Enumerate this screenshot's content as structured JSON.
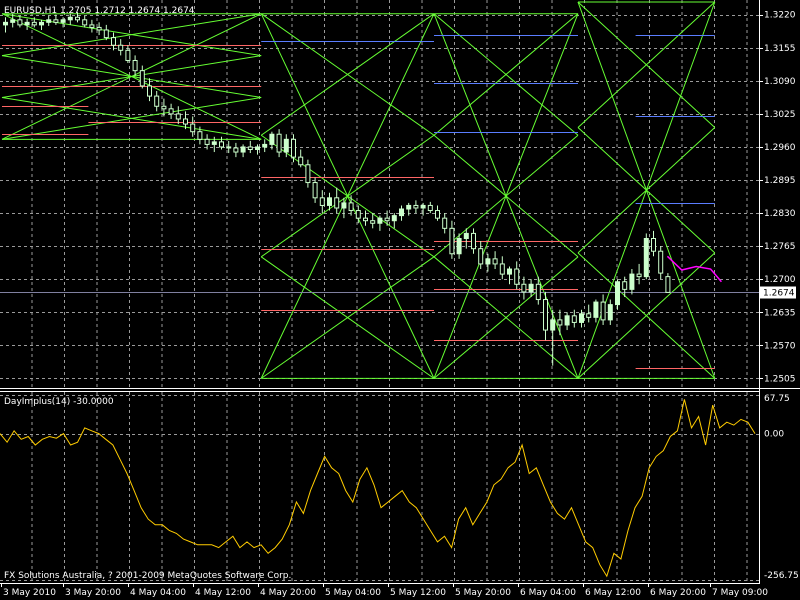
{
  "chart_data": [
    {
      "type": "candlestick",
      "header": "EURUSD,H1  1.2705 1.2712 1.2674 1.2674",
      "symbol": "EURUSD",
      "timeframe": "H1",
      "ohlc_header": [
        1.2705,
        1.2712,
        1.2674,
        1.2674
      ],
      "current_price": 1.2674,
      "current_price_label": "1.2674",
      "ylim": [
        1.249,
        1.3245
      ],
      "y_ticks": [
        1.322,
        1.3155,
        1.309,
        1.3025,
        1.296,
        1.2895,
        1.283,
        1.2765,
        1.27,
        1.2635,
        1.257,
        1.2505
      ],
      "y_tick_labels": [
        "1.3220",
        "1.3155",
        "1.3090",
        "1.3025",
        "1.2960",
        "1.2895",
        "1.2830",
        "1.2765",
        "1.2700",
        "1.2635",
        "1.2570",
        "1.2505"
      ],
      "x_tick_labels": [
        "3 May 2010",
        "3 May 20:00",
        "4 May 04:00",
        "4 May 12:00",
        "4 May 20:00",
        "5 May 04:00",
        "5 May 12:00",
        "5 May 20:00",
        "6 May 04:00",
        "6 May 12:00",
        "6 May 20:00",
        "7 May 09:00"
      ],
      "grid": true,
      "colors": {
        "background": "#000000",
        "grid": "#9a9a9a",
        "bull_candle": "#ccffcc",
        "bear_candle": "#000000",
        "candle_outline": "#ccffcc",
        "projection_lines": "#66ff33",
        "support_resistance": "#ff6666",
        "upper_levels": "#5a7dff",
        "forecast": "#ff00ff",
        "price_line": "#8080a0"
      },
      "candles_note": "hourly candles, open/high/low/close",
      "candles": [
        [
          1.32,
          1.3215,
          1.3185,
          1.3205
        ],
        [
          1.3205,
          1.3222,
          1.3195,
          1.321
        ],
        [
          1.321,
          1.3218,
          1.3195,
          1.32
        ],
        [
          1.32,
          1.3212,
          1.319,
          1.3205
        ],
        [
          1.3205,
          1.3215,
          1.3195,
          1.32
        ],
        [
          1.32,
          1.321,
          1.319,
          1.3205
        ],
        [
          1.3205,
          1.3218,
          1.3198,
          1.321
        ],
        [
          1.321,
          1.322,
          1.32,
          1.3205
        ],
        [
          1.3205,
          1.3215,
          1.3195,
          1.321
        ],
        [
          1.321,
          1.3222,
          1.32,
          1.3215
        ],
        [
          1.3215,
          1.3225,
          1.3205,
          1.321
        ],
        [
          1.321,
          1.3218,
          1.3195,
          1.32
        ],
        [
          1.32,
          1.321,
          1.3185,
          1.3195
        ],
        [
          1.3195,
          1.3205,
          1.318,
          1.319
        ],
        [
          1.319,
          1.32,
          1.317,
          1.3175
        ],
        [
          1.3175,
          1.3185,
          1.315,
          1.316
        ],
        [
          1.316,
          1.3172,
          1.314,
          1.315
        ],
        [
          1.315,
          1.316,
          1.3125,
          1.313
        ],
        [
          1.313,
          1.314,
          1.31,
          1.311
        ],
        [
          1.311,
          1.312,
          1.3075,
          1.308
        ],
        [
          1.308,
          1.3095,
          1.305,
          1.306
        ],
        [
          1.306,
          1.307,
          1.303,
          1.304
        ],
        [
          1.304,
          1.3055,
          1.302,
          1.3035
        ],
        [
          1.3035,
          1.3045,
          1.3015,
          1.3025
        ],
        [
          1.3025,
          1.304,
          1.3005,
          1.3015
        ],
        [
          1.3015,
          1.303,
          1.2995,
          1.3005
        ],
        [
          1.3005,
          1.302,
          1.298,
          1.299
        ],
        [
          1.299,
          1.3,
          1.2965,
          1.2975
        ],
        [
          1.2975,
          1.2985,
          1.2955,
          1.2965
        ],
        [
          1.2965,
          1.298,
          1.295,
          1.297
        ],
        [
          1.297,
          1.298,
          1.2955,
          1.296
        ],
        [
          1.296,
          1.2972,
          1.2948,
          1.2958
        ],
        [
          1.2958,
          1.2968,
          1.294,
          1.295
        ],
        [
          1.295,
          1.2965,
          1.294,
          1.296
        ],
        [
          1.296,
          1.2972,
          1.2948,
          1.2955
        ],
        [
          1.2955,
          1.2965,
          1.2945,
          1.296
        ],
        [
          1.296,
          1.2975,
          1.295,
          1.2965
        ],
        [
          1.2965,
          1.299,
          1.2955,
          1.2985
        ],
        [
          1.2985,
          1.2995,
          1.294,
          1.295
        ],
        [
          1.295,
          1.2985,
          1.294,
          1.2975
        ],
        [
          1.2975,
          1.2985,
          1.293,
          1.294
        ],
        [
          1.294,
          1.2955,
          1.292,
          1.2925
        ],
        [
          1.2925,
          1.2935,
          1.288,
          1.289
        ],
        [
          1.289,
          1.29,
          1.285,
          1.286
        ],
        [
          1.286,
          1.2875,
          1.283,
          1.2845
        ],
        [
          1.2845,
          1.287,
          1.2835,
          1.286
        ],
        [
          1.286,
          1.288,
          1.283,
          1.284
        ],
        [
          1.284,
          1.286,
          1.282,
          1.285
        ],
        [
          1.285,
          1.2865,
          1.2825,
          1.2835
        ],
        [
          1.2835,
          1.2845,
          1.281,
          1.282
        ],
        [
          1.282,
          1.2835,
          1.2805,
          1.2815
        ],
        [
          1.2815,
          1.283,
          1.28,
          1.281
        ],
        [
          1.281,
          1.2825,
          1.2795,
          1.282
        ],
        [
          1.282,
          1.2835,
          1.2805,
          1.2815
        ],
        [
          1.2815,
          1.283,
          1.28,
          1.2825
        ],
        [
          1.2825,
          1.2845,
          1.2815,
          1.2838
        ],
        [
          1.2838,
          1.285,
          1.2825,
          1.2845
        ],
        [
          1.2845,
          1.2855,
          1.283,
          1.284
        ],
        [
          1.284,
          1.285,
          1.2825,
          1.2845
        ],
        [
          1.2845,
          1.2852,
          1.283,
          1.2835
        ],
        [
          1.2835,
          1.2845,
          1.2815,
          1.282
        ],
        [
          1.282,
          1.283,
          1.279,
          1.28
        ],
        [
          1.28,
          1.2815,
          1.274,
          1.275
        ],
        [
          1.275,
          1.279,
          1.274,
          1.278
        ],
        [
          1.278,
          1.28,
          1.276,
          1.279
        ],
        [
          1.279,
          1.28,
          1.275,
          1.276
        ],
        [
          1.276,
          1.2775,
          1.272,
          1.273
        ],
        [
          1.273,
          1.275,
          1.2715,
          1.274
        ],
        [
          1.274,
          1.2755,
          1.272,
          1.273
        ],
        [
          1.273,
          1.2745,
          1.27,
          1.271
        ],
        [
          1.271,
          1.2725,
          1.269,
          1.272
        ],
        [
          1.272,
          1.2735,
          1.268,
          1.269
        ],
        [
          1.269,
          1.2705,
          1.266,
          1.2675
        ],
        [
          1.2675,
          1.27,
          1.2665,
          1.269
        ],
        [
          1.269,
          1.2705,
          1.265,
          1.266
        ],
        [
          1.266,
          1.2675,
          1.258,
          1.26
        ],
        [
          1.26,
          1.264,
          1.253,
          1.262
        ],
        [
          1.262,
          1.264,
          1.259,
          1.261
        ],
        [
          1.261,
          1.2635,
          1.26,
          1.2628
        ],
        [
          1.2628,
          1.264,
          1.2605,
          1.2615
        ],
        [
          1.2615,
          1.264,
          1.2605,
          1.2632
        ],
        [
          1.2632,
          1.265,
          1.2615,
          1.2625
        ],
        [
          1.2625,
          1.266,
          1.2615,
          1.2655
        ],
        [
          1.2655,
          1.267,
          1.261,
          1.262
        ],
        [
          1.262,
          1.266,
          1.261,
          1.265
        ],
        [
          1.265,
          1.27,
          1.264,
          1.2695
        ],
        [
          1.2695,
          1.2705,
          1.2665,
          1.268
        ],
        [
          1.268,
          1.272,
          1.267,
          1.271
        ],
        [
          1.271,
          1.273,
          1.269,
          1.2705
        ],
        [
          1.2705,
          1.279,
          1.27,
          1.278
        ],
        [
          1.278,
          1.2795,
          1.2745,
          1.2755
        ],
        [
          1.2755,
          1.2765,
          1.27,
          1.2712
        ],
        [
          1.2705,
          1.2712,
          1.2674,
          1.2674
        ]
      ],
      "projection_boxes": [
        {
          "x_from": 0,
          "x_to": 36,
          "top": 1.3222,
          "bottom": 1.2975
        },
        {
          "x_from": 36,
          "x_to": 60,
          "top": 1.3222,
          "bottom": 1.2505
        },
        {
          "x_from": 60,
          "x_to": 80,
          "top": 1.3222,
          "bottom": 1.2505
        },
        {
          "x_from": 80,
          "x_to": 99,
          "top": 1.3245,
          "bottom": 1.2505
        }
      ],
      "red_levels": [
        {
          "x_from": 0,
          "x_to": 12,
          "values": [
            1.316,
            1.308,
            1.304,
            1.2985
          ]
        },
        {
          "x_from": 12,
          "x_to": 36,
          "values": [
            1.316,
            1.308,
            1.301
          ]
        },
        {
          "x_from": 36,
          "x_to": 60,
          "values": [
            1.29,
            1.276,
            1.264
          ]
        },
        {
          "x_from": 60,
          "x_to": 80,
          "values": [
            1.2775,
            1.268,
            1.258
          ]
        },
        {
          "x_from": 88,
          "x_to": 99,
          "values": [
            1.2525
          ]
        }
      ],
      "blue_levels": [
        {
          "x_from": 36,
          "x_to": 60,
          "values": [
            1.3168
          ]
        },
        {
          "x_from": 60,
          "x_to": 80,
          "values": [
            1.318,
            1.3085,
            1.299
          ]
        },
        {
          "x_from": 88,
          "x_to": 99,
          "values": [
            1.318,
            1.302,
            1.285
          ]
        }
      ],
      "forecast": [
        [
          92,
          1.2745
        ],
        [
          94,
          1.2718
        ],
        [
          96,
          1.2725
        ],
        [
          98,
          1.272
        ],
        [
          99.5,
          1.2695
        ]
      ]
    },
    {
      "type": "line",
      "title": "DayImplus(14) -30.0000",
      "series": [
        {
          "name": "DayImplus(14)",
          "color": "#ffcc00",
          "values": [
            0,
            -15,
            5,
            -10,
            -5,
            -20,
            -10,
            -5,
            -8,
            0,
            -20,
            -15,
            10,
            5,
            0,
            -10,
            -20,
            -45,
            -70,
            -100,
            -130,
            -150,
            -160,
            -160,
            -170,
            -175,
            -185,
            -190,
            -195,
            -195,
            -195,
            -200,
            -190,
            -180,
            -200,
            -190,
            -200,
            -195,
            -210,
            -200,
            -185,
            -160,
            -120,
            -140,
            -100,
            -70,
            -40,
            -60,
            -70,
            -100,
            -120,
            -80,
            -60,
            -90,
            -130,
            -120,
            -110,
            -100,
            -120,
            -130,
            -150,
            -170,
            -190,
            -180,
            -200,
            -150,
            -130,
            -160,
            -140,
            -120,
            -90,
            -80,
            -60,
            -50,
            -20,
            -70,
            -60,
            -90,
            -120,
            -140,
            -150,
            -130,
            -160,
            -190,
            -200,
            -230,
            -250,
            -210,
            -220,
            -170,
            -130,
            -110,
            -60,
            -40,
            -30,
            -5,
            5,
            60,
            10,
            30,
            -20,
            50,
            10,
            20,
            15,
            25,
            20,
            0
          ]
        }
      ],
      "ylim": [
        -256.75,
        67.75
      ],
      "y_tick_labels": [
        "67.75",
        "0.00",
        "-256.75"
      ],
      "grid": true
    }
  ],
  "copyright": "FX Solutions Australia, ? 2001-2009 MetaQuotes Software Corp."
}
